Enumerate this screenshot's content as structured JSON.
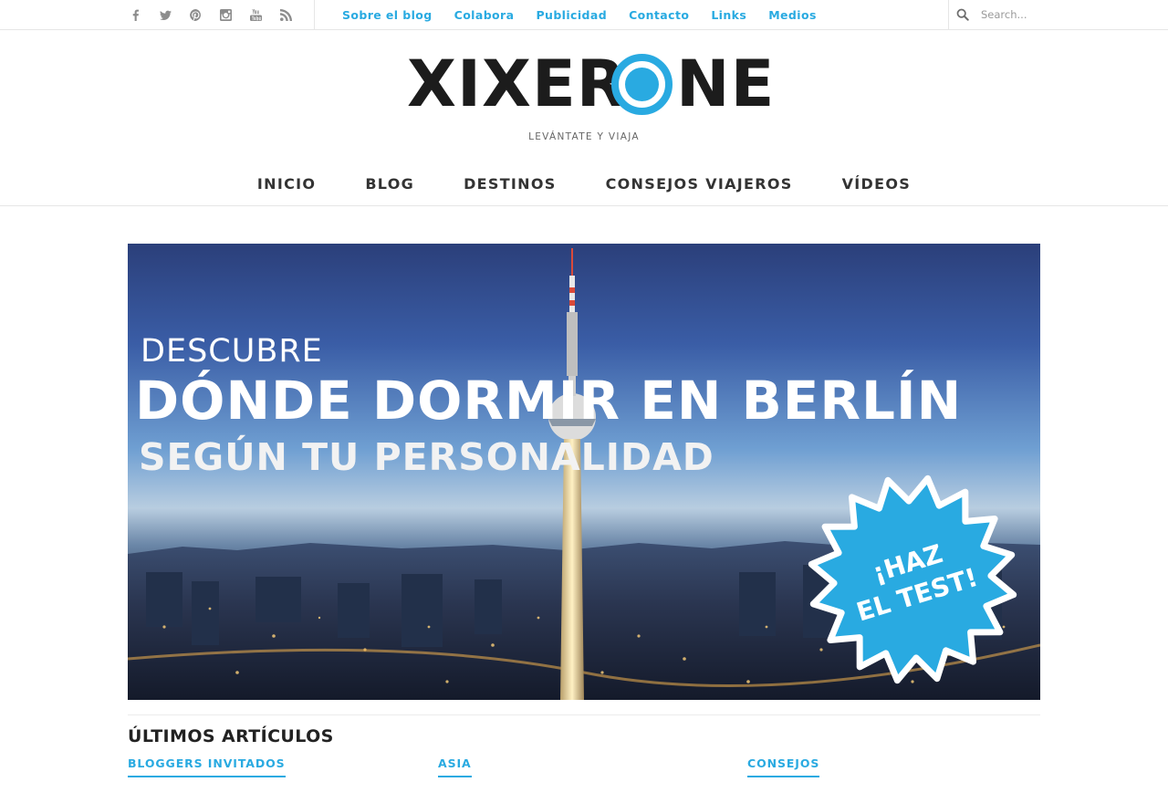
{
  "topbar": {
    "social": [
      {
        "icon": "facebook-icon"
      },
      {
        "icon": "twitter-icon"
      },
      {
        "icon": "pinterest-icon"
      },
      {
        "icon": "instagram-icon"
      },
      {
        "icon": "youtube-icon"
      },
      {
        "icon": "rss-icon"
      }
    ],
    "links": [
      "Sobre el blog",
      "Colabora",
      "Publicidad",
      "Contacto",
      "Links",
      "Medios"
    ],
    "search": {
      "placeholder": "Search...",
      "icon": "search-icon"
    }
  },
  "header": {
    "logo_left": "XIXER",
    "logo_right": "NE",
    "tagline": "LEVÁNTATE Y VIAJA"
  },
  "nav": [
    "INICIO",
    "BLOG",
    "DESTINOS",
    "CONSEJOS VIAJEROS",
    "VÍDEOS"
  ],
  "hero": {
    "line1": "DESCUBRE",
    "line2": "DÓNDE DORMIR EN BERLÍN",
    "line3": "SEGÚN TU PERSONALIDAD",
    "badge_line1": "¡HAZ",
    "badge_line2": "EL TEST!"
  },
  "latest": {
    "title": "ÚLTIMOS ARTÍCULOS",
    "categories": [
      "BLOGGERS INVITADOS",
      "ASIA",
      "CONSEJOS"
    ]
  },
  "colors": {
    "accent": "#29aae1",
    "text": "#222222",
    "muted": "#8c8c8c"
  }
}
